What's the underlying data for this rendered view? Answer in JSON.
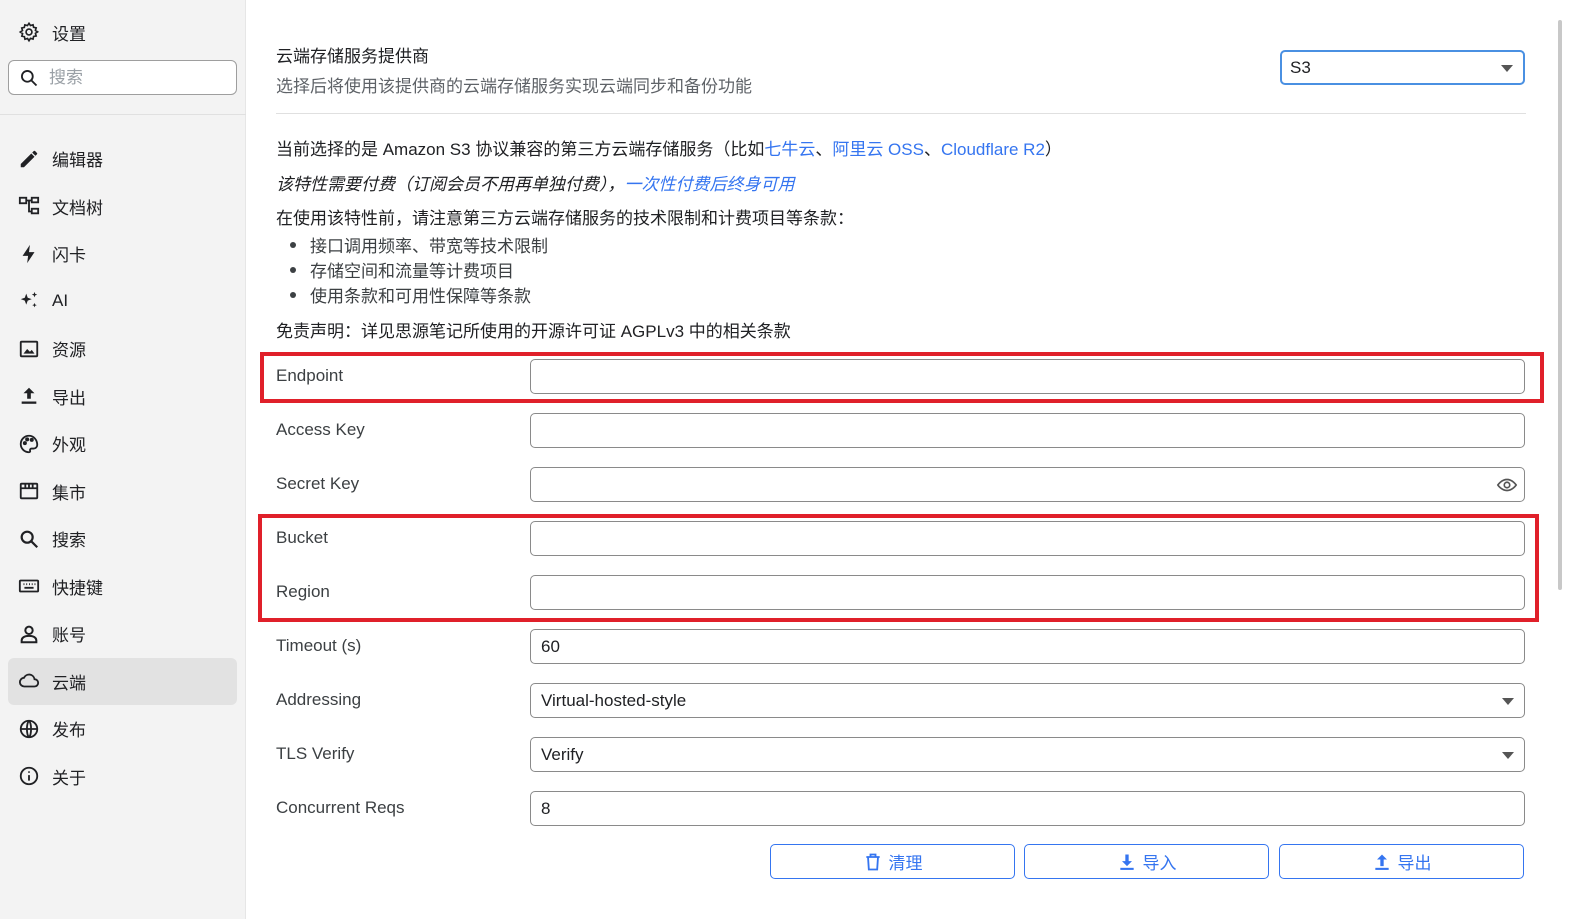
{
  "sidebar": {
    "title": "设置",
    "search_placeholder": "搜索",
    "items": [
      {
        "label": "编辑器",
        "icon": "pencil-icon"
      },
      {
        "label": "文档树",
        "icon": "tree-icon"
      },
      {
        "label": "闪卡",
        "icon": "lightning-icon"
      },
      {
        "label": "AI",
        "icon": "sparkle-icon"
      },
      {
        "label": "资源",
        "icon": "image-icon"
      },
      {
        "label": "导出",
        "icon": "upload-icon"
      },
      {
        "label": "外观",
        "icon": "palette-icon"
      },
      {
        "label": "集市",
        "icon": "store-icon"
      },
      {
        "label": "搜索",
        "icon": "search-icon"
      },
      {
        "label": "快捷键",
        "icon": "keyboard-icon"
      },
      {
        "label": "账号",
        "icon": "user-icon"
      },
      {
        "label": "云端",
        "icon": "cloud-icon"
      },
      {
        "label": "发布",
        "icon": "globe-icon"
      },
      {
        "label": "关于",
        "icon": "info-icon"
      }
    ],
    "active_item": "云端"
  },
  "provider": {
    "title": "云端存储服务提供商",
    "description": "选择后将使用该提供商的云端存储服务实现云端同步和备份功能",
    "selected": "S3"
  },
  "info": {
    "line1_prefix": "当前选择的是 Amazon S3 协议兼容的第三方云端存储服务（比如",
    "link_qiniu": "七牛云",
    "sep1": "、",
    "link_aliyun": "阿里云 OSS",
    "sep2": "、",
    "link_cloudflare": "Cloudflare R2",
    "line1_suffix": "）",
    "paid_note": "该特性需要付费（订阅会员不用再单独付费），",
    "paid_link": "一次性付费后终身可用",
    "notice": "在使用该特性前，请注意第三方云端存储服务的技术限制和计费项目等条款：",
    "bullets": [
      "接口调用频率、带宽等技术限制",
      "存储空间和流量等计费项目",
      "使用条款和可用性保障等条款"
    ],
    "disclaimer": "免责声明：详见思源笔记所使用的开源许可证 AGPLv3 中的相关条款"
  },
  "form": {
    "endpoint": {
      "label": "Endpoint",
      "value": ""
    },
    "access_key": {
      "label": "Access Key",
      "value": ""
    },
    "secret_key": {
      "label": "Secret Key",
      "value": ""
    },
    "bucket": {
      "label": "Bucket",
      "value": ""
    },
    "region": {
      "label": "Region",
      "value": ""
    },
    "timeout": {
      "label": "Timeout (s)",
      "value": "60"
    },
    "addressing": {
      "label": "Addressing",
      "value": "Virtual-hosted-style"
    },
    "tls_verify": {
      "label": "TLS Verify",
      "value": "Verify"
    },
    "concurrent": {
      "label": "Concurrent Reqs",
      "value": "8"
    }
  },
  "buttons": {
    "purge": "清理",
    "import": "导入",
    "export": "导出"
  },
  "colors": {
    "accent": "#3575f0",
    "highlight": "#e0202a",
    "sidebar_bg": "#f3f3f3"
  }
}
